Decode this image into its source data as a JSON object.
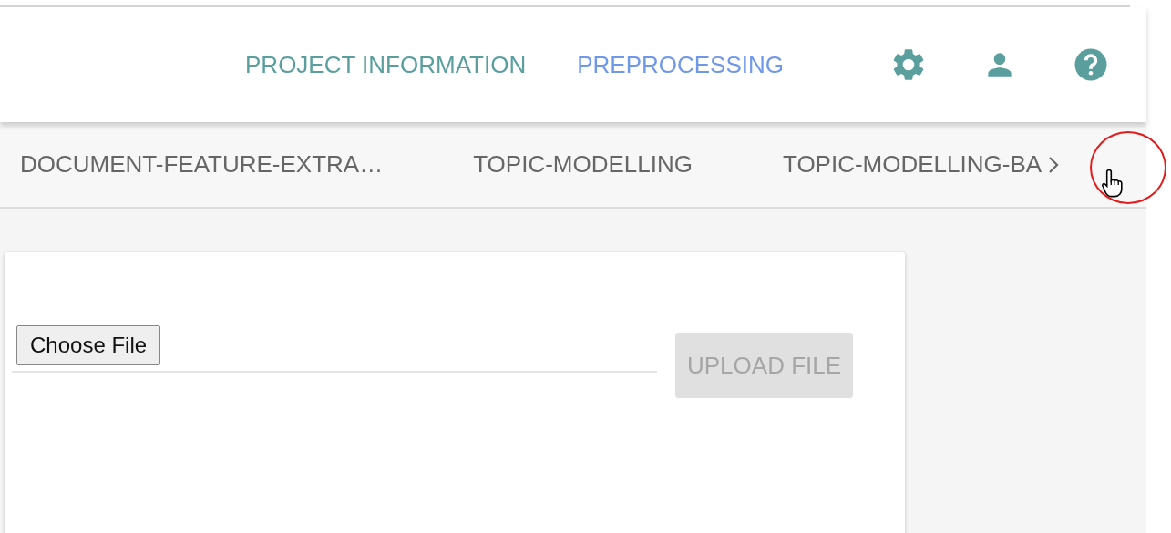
{
  "header": {
    "nav_links": [
      {
        "label": "PROJECT INFORMATION",
        "selected": false
      },
      {
        "label": "PREPROCESSING",
        "selected": true
      }
    ]
  },
  "tabs": [
    {
      "label": "DOCUMENT-FEATURE-EXTRA…"
    },
    {
      "label": "TOPIC-MODELLING"
    },
    {
      "label": "TOPIC-MODELLING-BA"
    }
  ],
  "upload_form": {
    "file_button": "Choose File",
    "upload_button": {
      "label": "UPLOAD FILE",
      "disabled": true
    }
  }
}
